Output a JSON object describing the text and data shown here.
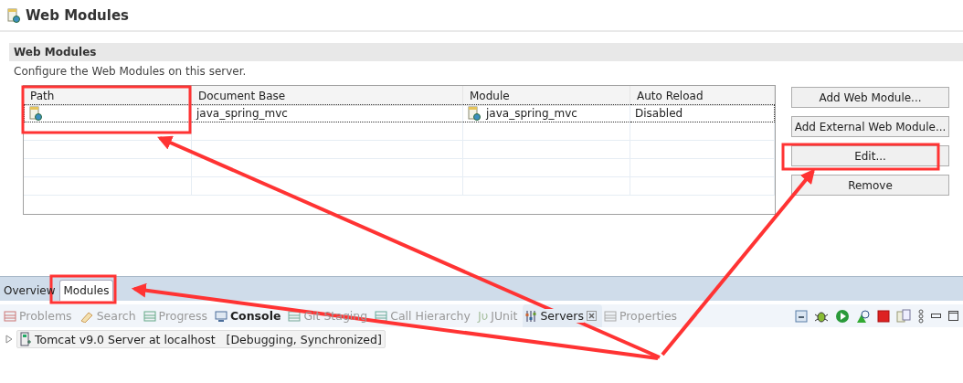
{
  "page_title": "Web Modules",
  "section": {
    "title": "Web Modules",
    "description": "Configure the Web Modules on this server."
  },
  "table": {
    "columns": [
      "Path",
      "Document Base",
      "Module",
      "Auto Reload"
    ],
    "rows": [
      {
        "document_base": "java_spring_mvc",
        "module": "java_spring_mvc",
        "auto_reload": "Disabled",
        "selected": true
      }
    ]
  },
  "buttons": [
    "Add Web Module...",
    "Add External Web Module...",
    "Edit...",
    "Remove"
  ],
  "editor_tabs": [
    {
      "label": "Overview",
      "selected": false
    },
    {
      "label": "Modules",
      "selected": true
    }
  ],
  "view_tabs": [
    {
      "kind": "problems",
      "label": "Problems",
      "selected": false,
      "bold": false
    },
    {
      "kind": "search",
      "label": "Search",
      "selected": false,
      "bold": false
    },
    {
      "kind": "progress",
      "label": "Progress",
      "selected": false,
      "bold": false
    },
    {
      "kind": "console",
      "label": "Console",
      "selected": false,
      "bold": true
    },
    {
      "kind": "git",
      "label": "Git Staging",
      "selected": false,
      "bold": false
    },
    {
      "kind": "hierarchy",
      "label": "Call Hierarchy",
      "selected": false,
      "bold": false
    },
    {
      "kind": "junit",
      "label": "JUnit",
      "selected": false,
      "bold": false
    },
    {
      "kind": "servers",
      "label": "Servers",
      "selected": true,
      "bold": false
    },
    {
      "kind": "properties",
      "label": "Properties",
      "selected": false,
      "bold": false
    }
  ],
  "junit_glyph": "Jυ",
  "servers": [
    {
      "name": "Tomcat v9.0 Server at localhost",
      "status": "[Debugging, Synchronized]",
      "expanded": false
    }
  ]
}
